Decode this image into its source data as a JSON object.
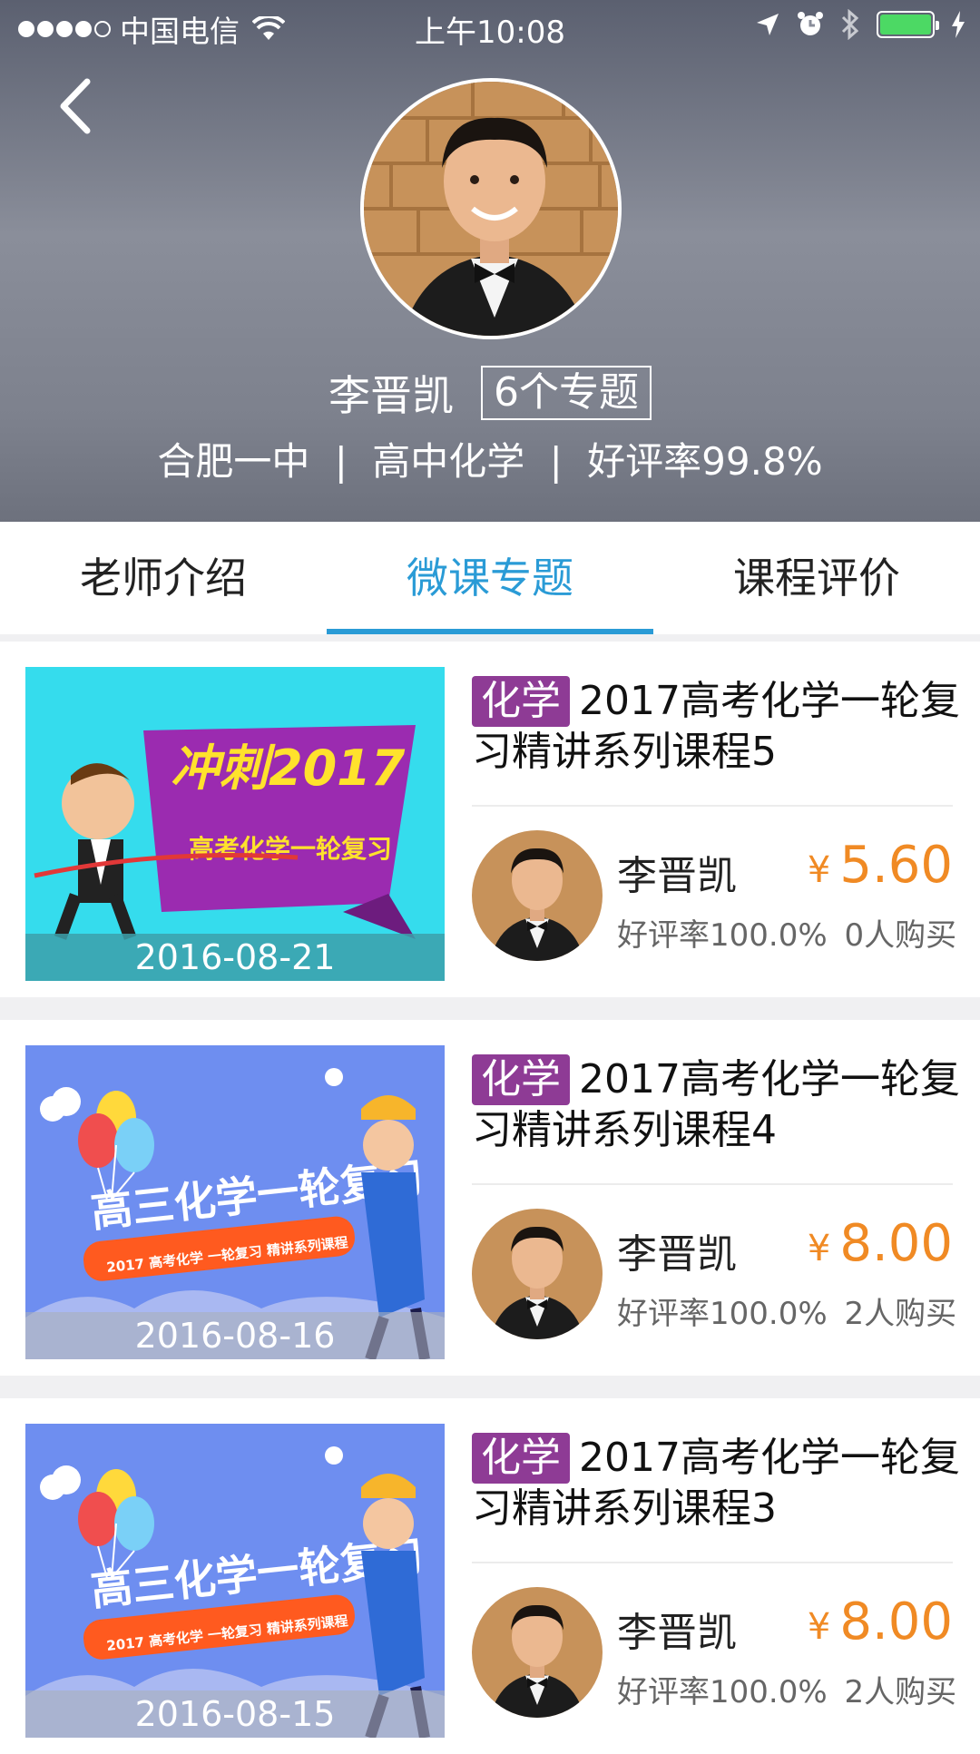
{
  "status_bar": {
    "carrier": "中国电信",
    "time": "上午10:08"
  },
  "profile": {
    "name": "李晋凯",
    "topic_count": "6个专题",
    "school": "合肥一中",
    "subject": "高中化学",
    "rating": "好评率99.8%",
    "separator": "|"
  },
  "tabs": [
    {
      "label": "老师介绍",
      "active": false
    },
    {
      "label": "微课专题",
      "active": true
    },
    {
      "label": "课程评价",
      "active": false
    }
  ],
  "courses": [
    {
      "date": "2016-08-21",
      "tag": "化学",
      "title": "2017高考化学一轮复习精讲系列课程5",
      "teacher": "李晋凯",
      "currency": "¥",
      "price": "5.60",
      "rating": "好评率100.0%",
      "buyers": "0人购买",
      "banner_text": "冲刺2017",
      "banner_sub": "高考化学一轮复习"
    },
    {
      "date": "2016-08-16",
      "tag": "化学",
      "title": "2017高考化学一轮复习精讲系列课程4",
      "teacher": "李晋凯",
      "currency": "¥",
      "price": "8.00",
      "rating": "好评率100.0%",
      "buyers": "2人购买",
      "banner_text": "高三化学一轮复习",
      "banner_sub": "2017 高考化学 一轮复习 精讲系列课程"
    },
    {
      "date": "2016-08-15",
      "tag": "化学",
      "title": "2017高考化学一轮复习精讲系列课程3",
      "teacher": "李晋凯",
      "currency": "¥",
      "price": "8.00",
      "rating": "好评率100.0%",
      "buyers": "2人购买",
      "banner_text": "高三化学一轮复习",
      "banner_sub": "2017 高考化学 一轮复习 精讲系列课程"
    }
  ],
  "colors": {
    "accent": "#2a9bd6",
    "price": "#f08a24",
    "tag": "#8e3b95"
  }
}
